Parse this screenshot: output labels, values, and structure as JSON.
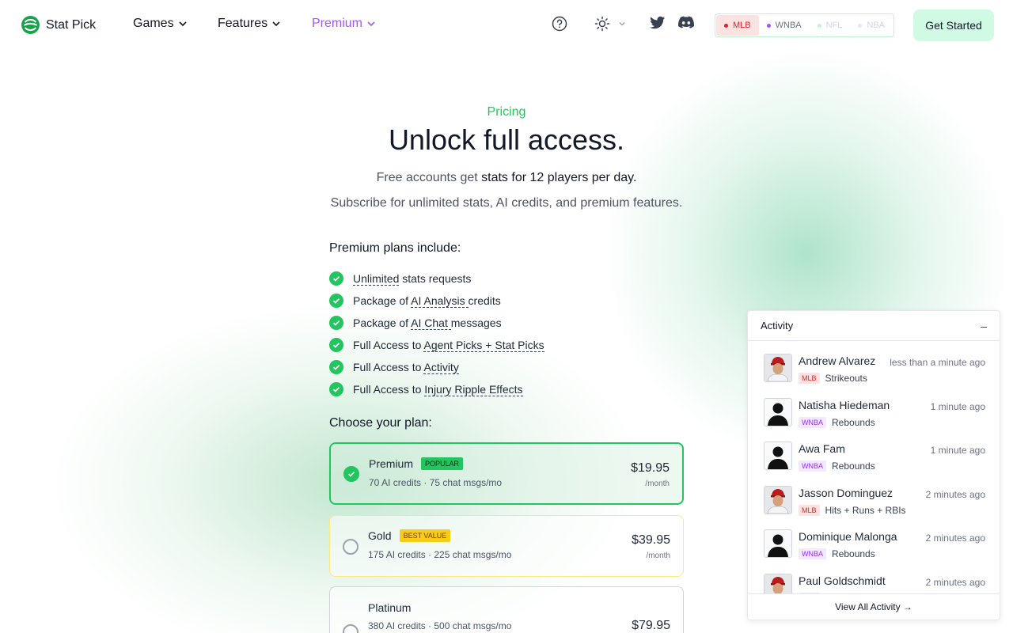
{
  "brand": {
    "name": "Stat Pick"
  },
  "nav": {
    "games_label": "Games",
    "features_label": "Features",
    "premium_label": "Premium",
    "leagues": [
      "MLB",
      "WNBA",
      "NFL",
      "NBA"
    ],
    "cta_label": "Get Started"
  },
  "hero": {
    "eyebrow": "Pricing",
    "title": "Unlock full access.",
    "sub_prefix": "Free accounts get",
    "sub_highlight": "stats for 12 players per day.",
    "sub_line2": "Subscribe for unlimited stats, AI credits, and premium features."
  },
  "includes": {
    "heading": "Premium plans include:",
    "items": [
      {
        "pre": "",
        "link": "Unlimited",
        "post": " stats requests"
      },
      {
        "pre": "Package of ",
        "link": "AI Analysis ",
        "post": "credits"
      },
      {
        "pre": "Package of ",
        "link": "AI Chat ",
        "post": "messages"
      },
      {
        "pre": "Full Access to ",
        "link": "Agent Picks + Stat Picks",
        "post": ""
      },
      {
        "pre": "Full Access to ",
        "link": "Activity",
        "post": ""
      },
      {
        "pre": "Full Access to ",
        "link": "Injury Ripple Effects",
        "post": ""
      }
    ]
  },
  "plans": {
    "heading": "Choose your plan:",
    "items": [
      {
        "name": "Premium",
        "badge": "POPULAR",
        "desc": "70 AI credits · 75 chat msgs/mo",
        "price": "$19.95",
        "period": "/month"
      },
      {
        "name": "Gold",
        "badge": "BEST VALUE",
        "desc": "175 AI credits · 225 chat msgs/mo",
        "price": "$39.95",
        "period": "/month"
      },
      {
        "name": "Platinum",
        "badge": "",
        "desc": "380 AI credits · 500 chat msgs/mo",
        "price": "$79.95",
        "period": ""
      }
    ]
  },
  "activity": {
    "title": "Activity",
    "minimize_glyph": "–",
    "view_all": "View All Activity →",
    "items": [
      {
        "name": "Andrew Alvarez",
        "time": "less than a minute ago",
        "league": "MLB",
        "stat": "Strikeouts",
        "avatar": "player-photo"
      },
      {
        "name": "Natisha Hiedeman",
        "time": "1 minute ago",
        "league": "WNBA",
        "stat": "Rebounds",
        "avatar": "silhouette"
      },
      {
        "name": "Awa Fam",
        "time": "1 minute ago",
        "league": "WNBA",
        "stat": "Rebounds",
        "avatar": "silhouette"
      },
      {
        "name": "Jasson Dominguez",
        "time": "2 minutes ago",
        "league": "MLB",
        "stat": "Hits + Runs + RBIs",
        "avatar": "player-photo"
      },
      {
        "name": "Dominique Malonga",
        "time": "2 minutes ago",
        "league": "WNBA",
        "stat": "Rebounds",
        "avatar": "silhouette"
      },
      {
        "name": "Paul Goldschmidt",
        "time": "2 minutes ago",
        "league": "MLB",
        "stat": "",
        "avatar": "player-photo"
      }
    ]
  },
  "colors": {
    "accent": "#22c55e",
    "premium": "#a855f7",
    "mlb": "#dc2626",
    "wnba": "#9333ea",
    "gold": "#facc15"
  }
}
